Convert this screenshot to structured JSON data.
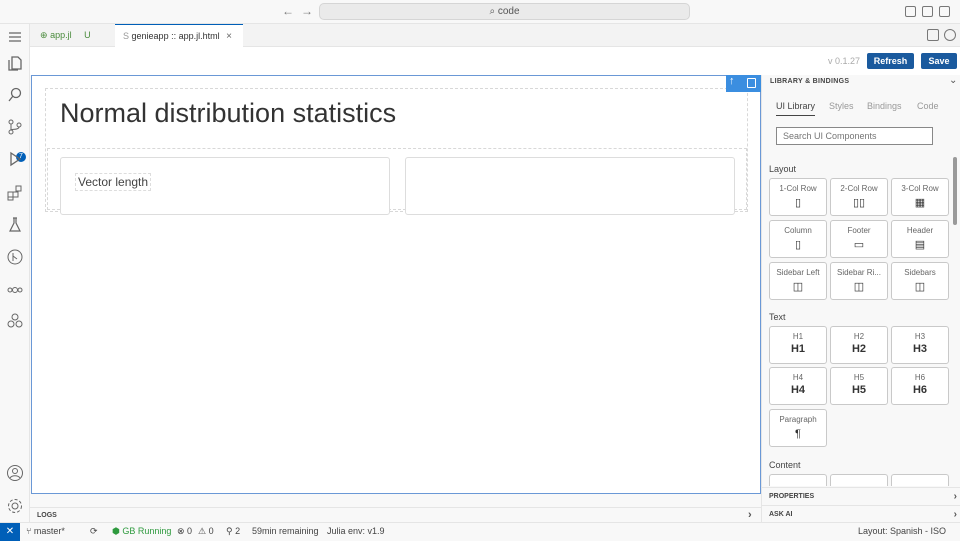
{
  "titlebar": {
    "back_glyph": "←",
    "forward_glyph": "→",
    "command_center": "code",
    "search_glyph": "⌕"
  },
  "activity_bar": {
    "icons": [
      "explorer-icon",
      "search-icon",
      "source-control-icon",
      "run-debug-icon",
      "extensions-icon",
      "testing-icon",
      "git-graph-icon",
      "julia-icon",
      "genie-icon",
      "account-icon",
      "settings-icon"
    ],
    "scm_badge": "7"
  },
  "tabs": [
    {
      "label": "app.jl",
      "badge": "U",
      "prefix": "⊕"
    },
    {
      "label": "genieapp :: app.jl.html",
      "prefix": "S",
      "close": "×"
    }
  ],
  "toolbar": {
    "version": "v 0.1.27",
    "refresh_label": "Refresh",
    "save_label": "Save"
  },
  "canvas": {
    "title": "Normal distribution statistics",
    "card_label": "Vector length"
  },
  "logs": {
    "label": "LOGS",
    "chevron": "›"
  },
  "panel": {
    "header": "LIBRARY & BINDINGS",
    "collapse_glyph": "⌄",
    "tabs": [
      "UI Library",
      "Styles",
      "Bindings",
      "Code"
    ],
    "search_placeholder": "Search UI Components",
    "sections": {
      "layout": "Layout",
      "text": "Text",
      "content": "Content"
    },
    "layout_items": [
      {
        "label": "1-Col Row",
        "icon": "▯"
      },
      {
        "label": "2-Col Row",
        "icon": "▯▯"
      },
      {
        "label": "3-Col Row",
        "icon": "▦"
      },
      {
        "label": "Column",
        "icon": "▯"
      },
      {
        "label": "Footer",
        "icon": "▭"
      },
      {
        "label": "Header",
        "icon": "▤"
      },
      {
        "label": "Sidebar Left",
        "icon": "◫"
      },
      {
        "label": "Sidebar Ri...",
        "icon": "◫"
      },
      {
        "label": "Sidebars",
        "icon": "◫"
      }
    ],
    "text_items": [
      {
        "label": "H1",
        "big": "H1"
      },
      {
        "label": "H2",
        "big": "H2"
      },
      {
        "label": "H3",
        "big": "H3"
      },
      {
        "label": "H4",
        "big": "H4"
      },
      {
        "label": "H5",
        "big": "H5"
      },
      {
        "label": "H6",
        "big": "H6"
      },
      {
        "label": "Paragraph",
        "big": "¶"
      }
    ],
    "properties": "PROPERTIES",
    "ask_ai": "ASK AI",
    "chevron": "›"
  },
  "status": {
    "remote_glyph": "✕",
    "branch": "master*",
    "gb_status": "GB Running",
    "errors": "⊗ 0",
    "warnings": "⚠ 0",
    "ports": "2",
    "remaining": "59min remaining",
    "julia_env": "Julia env: v1.9",
    "layout": "Layout: Spanish - ISO"
  },
  "colors": {
    "accent": "#005fb8",
    "button": "#1a5a9e",
    "canvas_border": "#6a98d6",
    "running": "#2e9a3e"
  }
}
